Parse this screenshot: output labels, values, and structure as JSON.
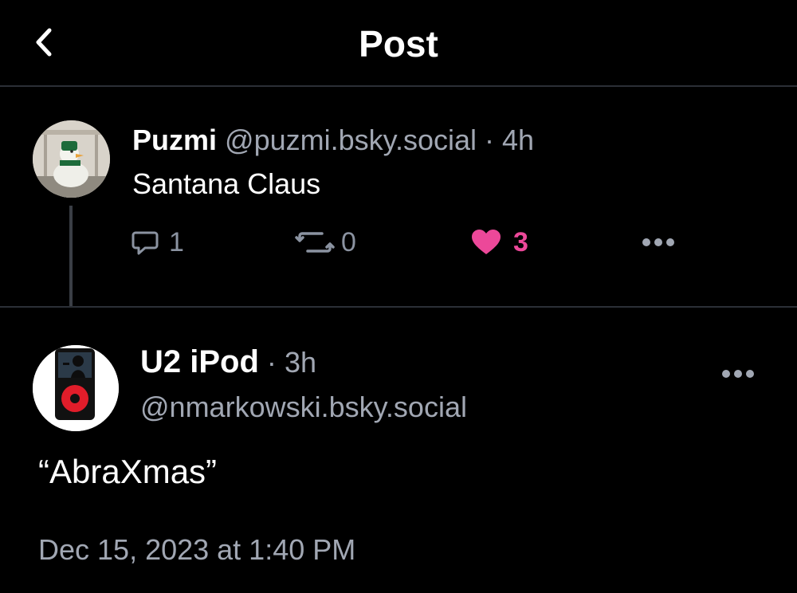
{
  "header": {
    "title": "Post"
  },
  "parent_post": {
    "display_name": "Puzmi",
    "handle": "@puzmi.bsky.social",
    "time": "4h",
    "text": "Santana Claus",
    "reply_count": "1",
    "repost_count": "0",
    "like_count": "3",
    "like_color": "#ec4899"
  },
  "main_post": {
    "display_name": "U2 iPod",
    "time": "3h",
    "handle": "@nmarkowski.bsky.social",
    "text": "“AbraXmas”",
    "timestamp": "Dec 15, 2023 at 1:40 PM"
  }
}
